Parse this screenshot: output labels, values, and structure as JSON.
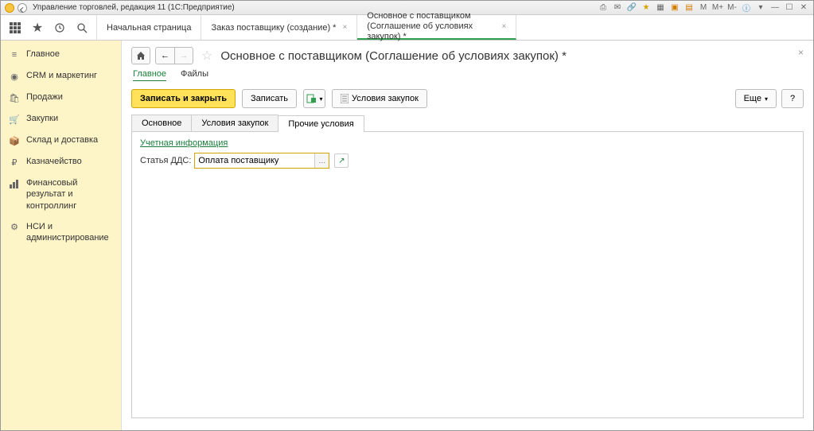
{
  "titlebar": {
    "title": "Управление торговлей, редакция 11  (1С:Предприятие)",
    "right_labels": [
      "M",
      "M+",
      "M-"
    ]
  },
  "top_tabs": [
    {
      "label": "Начальная страница",
      "closable": false
    },
    {
      "label": "Заказ поставщику (создание) *",
      "closable": true
    },
    {
      "label": "Основное с поставщиком (Соглашение об условиях закупок) *",
      "closable": true,
      "active": true
    }
  ],
  "sidebar": {
    "items": [
      {
        "label": "Главное",
        "icon": "home"
      },
      {
        "label": "CRM и маркетинг",
        "icon": "crm"
      },
      {
        "label": "Продажи",
        "icon": "bag"
      },
      {
        "label": "Закупки",
        "icon": "cart"
      },
      {
        "label": "Склад и доставка",
        "icon": "box"
      },
      {
        "label": "Казначейство",
        "icon": "ruble"
      },
      {
        "label": "Финансовый результат и контроллинг",
        "icon": "chart"
      },
      {
        "label": "НСИ и администрирование",
        "icon": "gear"
      }
    ]
  },
  "page": {
    "title": "Основное с поставщиком (Соглашение об условиях закупок) *",
    "subnav": [
      "Главное",
      "Файлы"
    ],
    "subnav_active": 0,
    "actions": {
      "save_close": "Записать и закрыть",
      "save": "Записать",
      "terms": "Условия закупок",
      "more": "Еще"
    },
    "inner_tabs": [
      "Основное",
      "Условия закупок",
      "Прочие условия"
    ],
    "inner_active": 2,
    "section_title": "Учетная информация",
    "field_label": "Статья ДДС:",
    "field_value": "Оплата поставщику"
  }
}
